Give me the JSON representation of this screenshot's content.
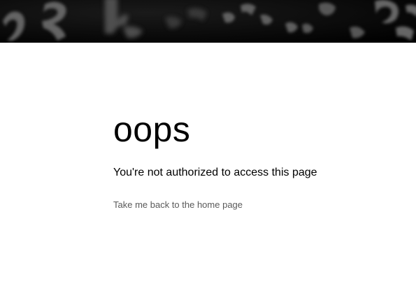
{
  "error": {
    "title": "oops",
    "message": "You're not authorized to access this page"
  },
  "links": {
    "home_label": "Take me back to the home page"
  },
  "colors": {
    "banner_background": "#050505",
    "title_text": "#000000",
    "link_text": "#5a5a5a",
    "page_background": "#ffffff"
  }
}
